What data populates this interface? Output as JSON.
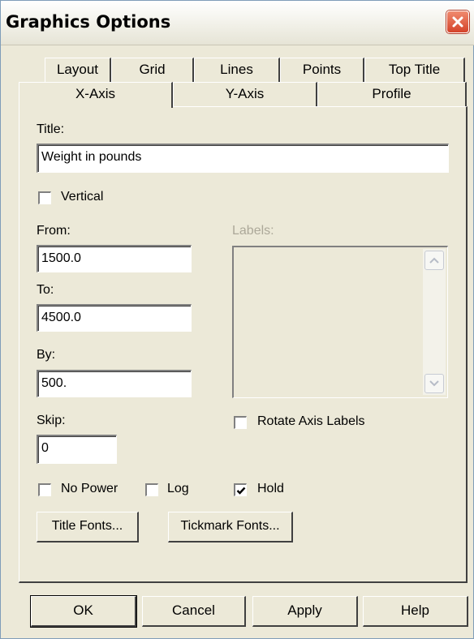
{
  "window": {
    "title": "Graphics Options"
  },
  "tabs": {
    "back_row": [
      "Layout",
      "Grid",
      "Lines",
      "Points",
      "Top Title"
    ],
    "front_row": [
      "X-Axis",
      "Y-Axis",
      "Profile"
    ],
    "selected": "X-Axis"
  },
  "xaxis": {
    "title_label": "Title:",
    "title_value": "Weight in pounds",
    "vertical_label": "Vertical",
    "vertical_checked": false,
    "from_label": "From:",
    "from_value": "1500.0",
    "to_label": "To:",
    "to_value": "4500.0",
    "by_label": "By:",
    "by_value": "500.",
    "skip_label": "Skip:",
    "skip_value": "0",
    "labels_label": "Labels:",
    "rotate_label": "Rotate Axis Labels",
    "rotate_checked": false,
    "nopower_label": "No Power",
    "nopower_checked": false,
    "log_label": "Log",
    "log_checked": false,
    "hold_label": "Hold",
    "hold_checked": true,
    "title_fonts_label": "Title Fonts...",
    "tickmark_fonts_label": "Tickmark Fonts..."
  },
  "buttons": {
    "ok": "OK",
    "cancel": "Cancel",
    "apply": "Apply",
    "help": "Help"
  },
  "icons": {
    "close": "close-icon",
    "check": "check-icon",
    "scroll_up": "chevron-up-icon",
    "scroll_down": "chevron-down-icon"
  }
}
